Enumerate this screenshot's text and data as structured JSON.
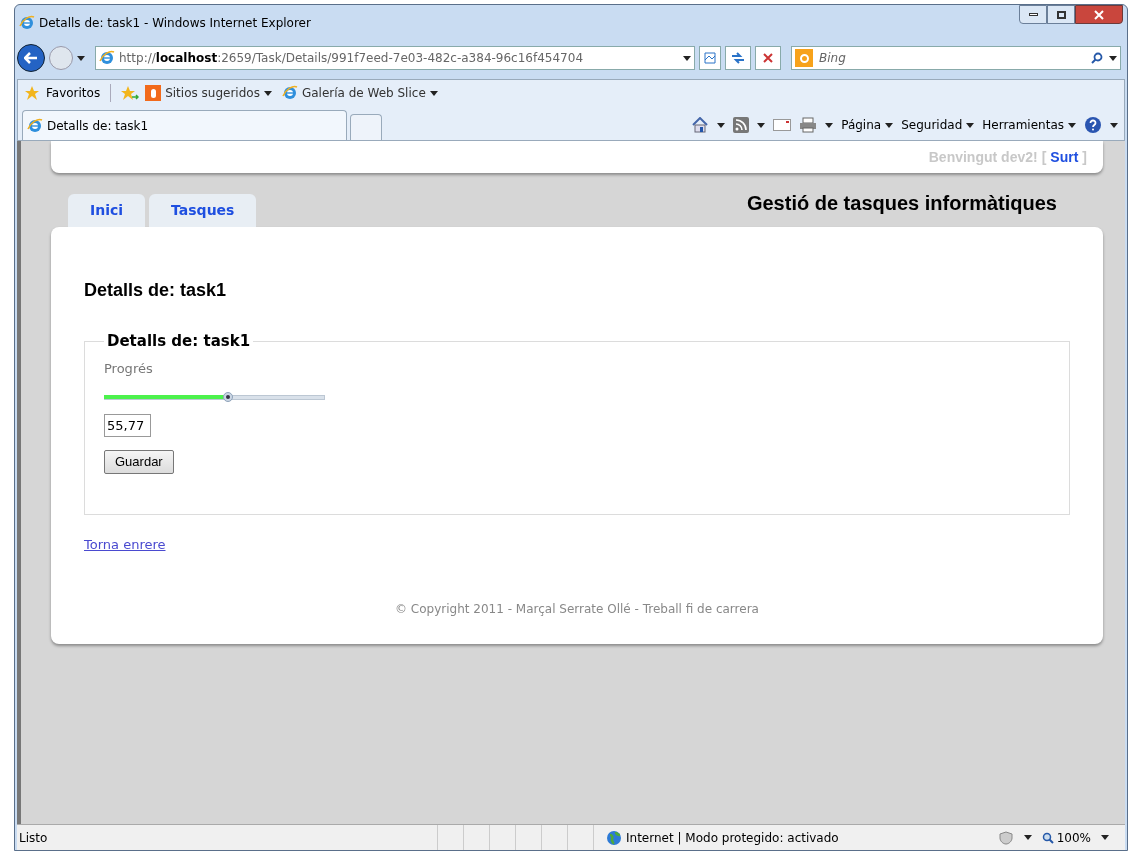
{
  "window": {
    "title": "Detalls de: task1 - Windows Internet Explorer"
  },
  "address_bar": {
    "url": "http://**localhost**:2659/Task/Details/991f7eed-7e03-482c-a384-96c16f454704"
  },
  "search": {
    "placeholder": "Bing"
  },
  "favorites_bar": {
    "favorites": "Favoritos",
    "items": [
      "Sitios sugeridos",
      "Galería de Web Slice"
    ]
  },
  "browser_tabs": [
    {
      "label": "Detalls de: task1"
    }
  ],
  "command_bar": [
    "Página",
    "Seguridad",
    "Herramientas"
  ],
  "page": {
    "greeting": "Benvingut dev2!",
    "bracket_open": "[",
    "logout": "Surt",
    "bracket_close": "]",
    "site_title": "Gestió de tasques informàtiques",
    "tabs": [
      "Inici",
      "Tasques"
    ],
    "heading": "Detalls de: task1",
    "fieldset": {
      "legend": "Detalls de: task1",
      "field_label": "Progrés",
      "slider": {
        "level": 0.56
      },
      "value": "55,77",
      "button": "Guardar"
    },
    "back_link": "Torna enrere",
    "footer": "© Copyright 2011 - Marçal Serrate Ollé - Treball fi de carrera"
  },
  "status_bar": {
    "status": "Listo",
    "zone": "Internet | Modo protegido: activado",
    "zoom": "100%"
  }
}
